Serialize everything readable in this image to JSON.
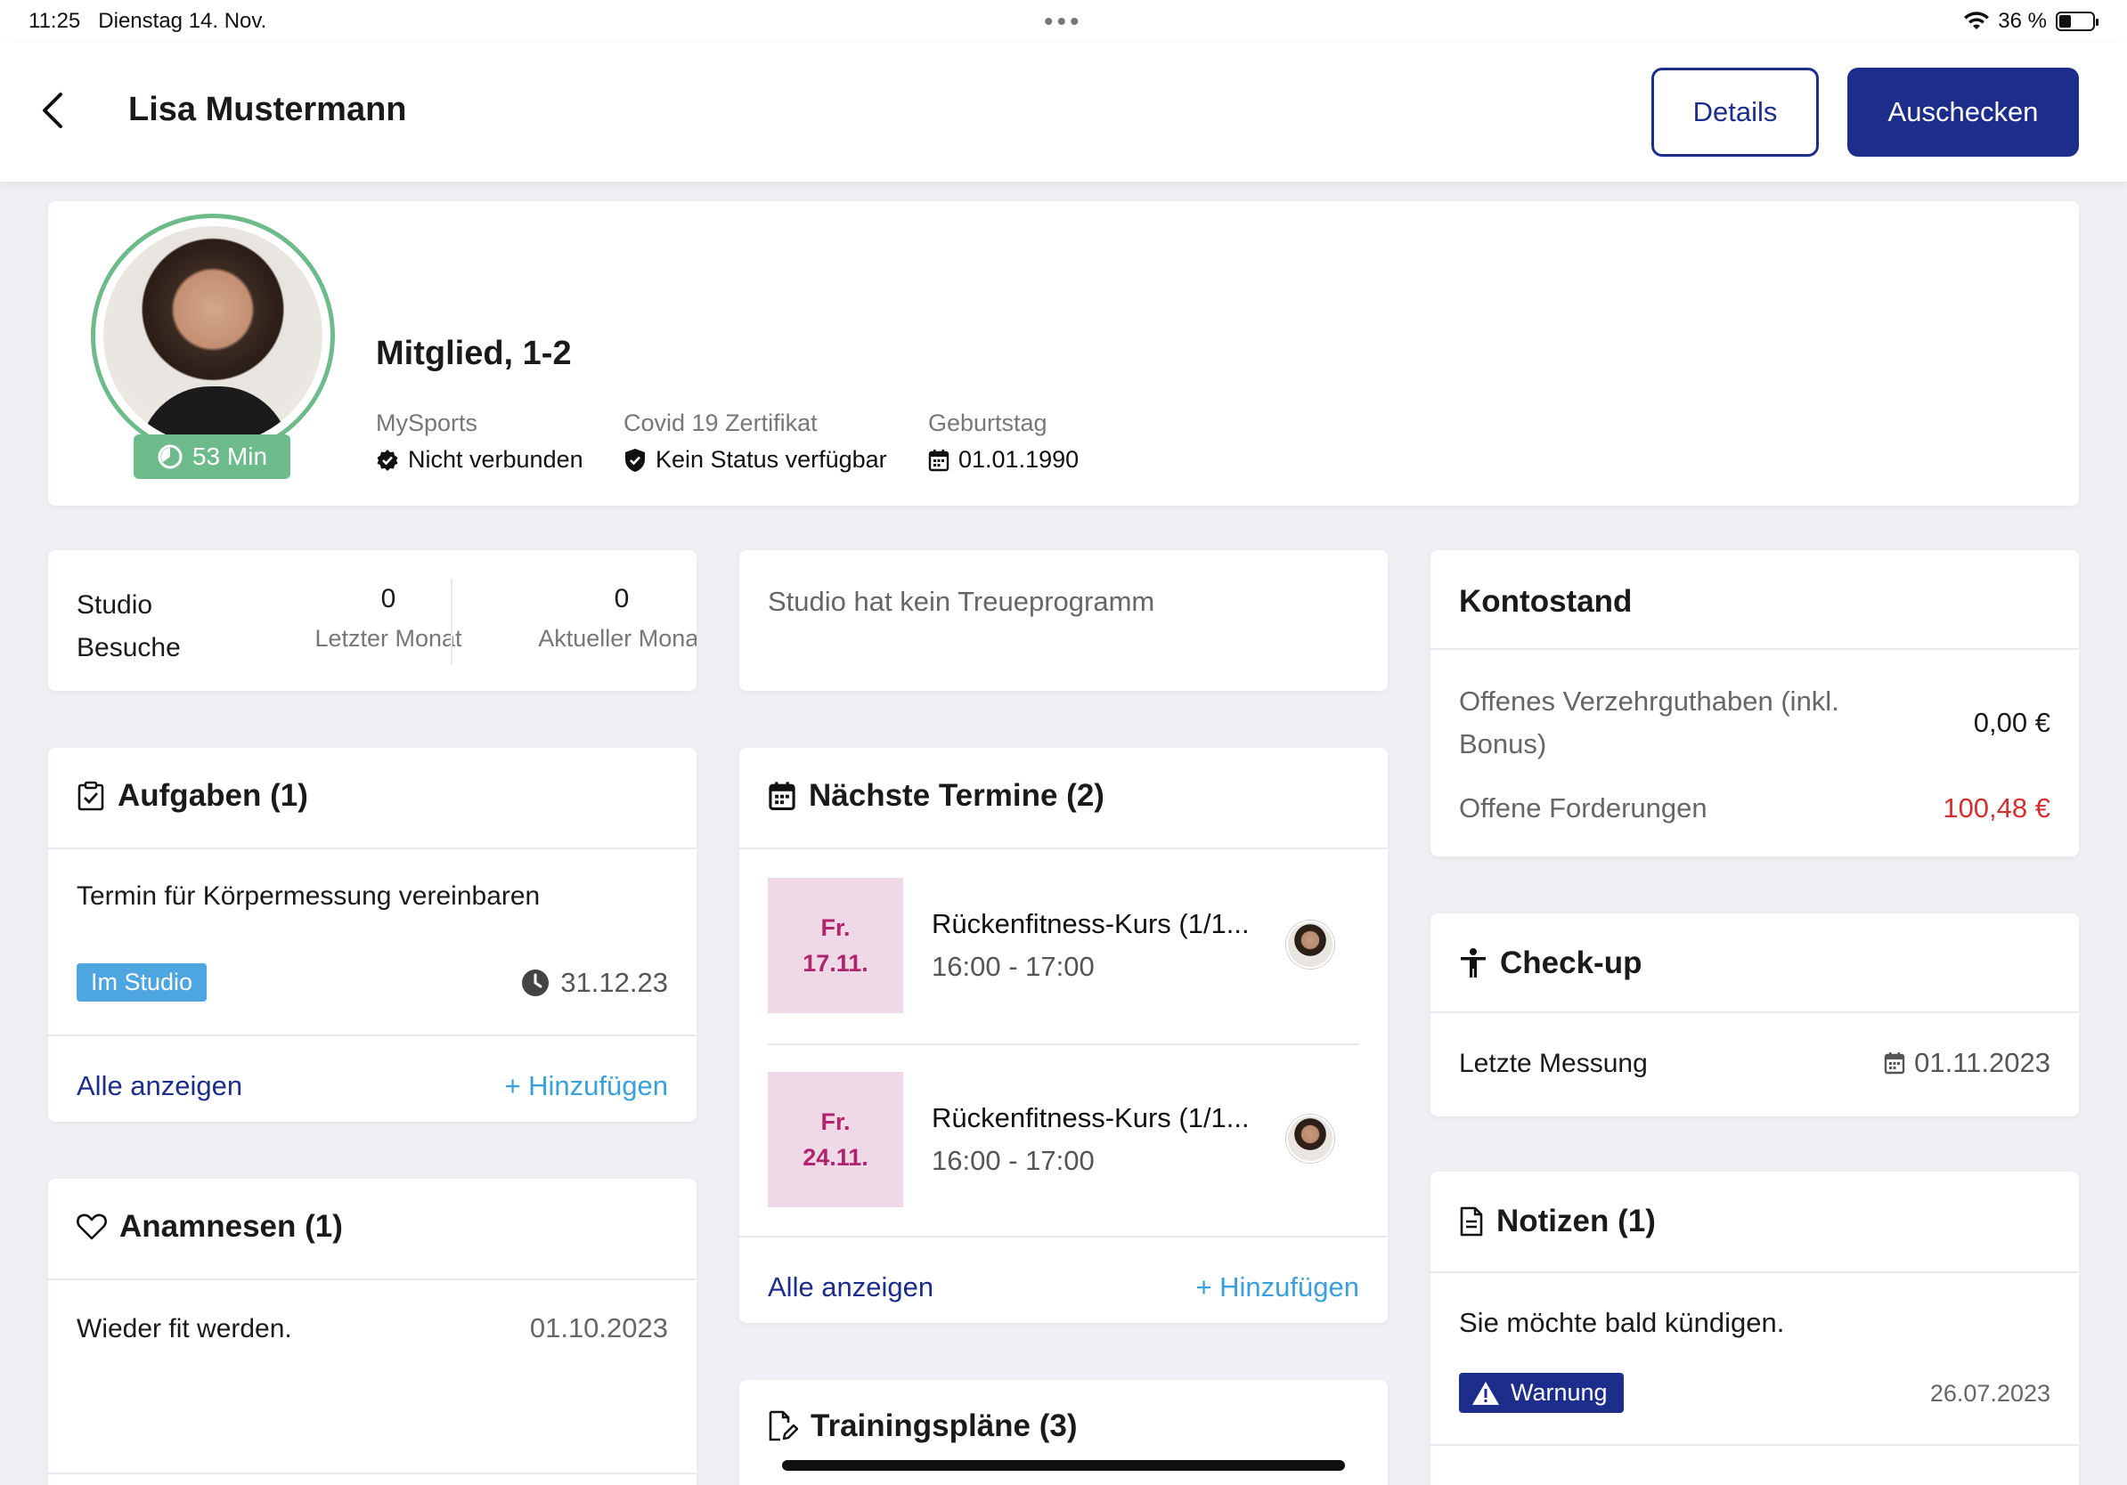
{
  "status_bar": {
    "time": "11:25",
    "date": "Dienstag 14. Nov.",
    "battery": "36 %",
    "battery_level": 0.36
  },
  "header": {
    "title": "Lisa Mustermann",
    "details_label": "Details",
    "checkout_label": "Auschecken"
  },
  "profile": {
    "duration": "53 Min",
    "membership": "Mitglied, 1-2",
    "mysports_label": "MySports",
    "mysports_value": "Nicht verbunden",
    "covid_label": "Covid 19 Zertifikat",
    "covid_value": "Kein Status verfügbar",
    "birthday_label": "Geburtstag",
    "birthday_value": "01.01.1990"
  },
  "visits": {
    "label_line1": "Studio",
    "label_line2": "Besuche",
    "last_month_count": "0",
    "last_month_label": "Letzter Monat",
    "current_month_count": "0",
    "current_month_label": "Aktueller Monat"
  },
  "loyalty": {
    "text": "Studio hat kein Treueprogramm"
  },
  "account": {
    "title": "Kontostand",
    "credit_label_line1": "Offenes Verzehrguthaben (inkl.",
    "credit_label_line2": "Bonus)",
    "credit_value": "0,00 €",
    "claims_label": "Offene Forderungen",
    "claims_value": "100,48 €",
    "claims_color": "#d32f2f"
  },
  "tasks": {
    "title": "Aufgaben (1)",
    "item_text": "Termin für Körpermessung vereinbaren",
    "item_tag": "Im Studio",
    "item_date": "31.12.23",
    "show_all": "Alle anzeigen",
    "add": "+ Hinzufügen"
  },
  "appointments": {
    "title": "Nächste Termine (2)",
    "items": [
      {
        "day": "Fr.",
        "date": "17.11.",
        "title": "Rückenfitness-Kurs (1/1...",
        "time": "16:00 - 17:00"
      },
      {
        "day": "Fr.",
        "date": "24.11.",
        "title": "Rückenfitness-Kurs (1/1...",
        "time": "16:00 - 17:00"
      }
    ],
    "show_all": "Alle anzeigen",
    "add": "+ Hinzufügen"
  },
  "checkup": {
    "title": "Check-up",
    "last_label": "Letzte Messung",
    "last_date": "01.11.2023"
  },
  "anamnesis": {
    "title": "Anamnesen (1)",
    "item_text": "Wieder fit werden.",
    "item_date": "01.10.2023"
  },
  "notes": {
    "title": "Notizen (1)",
    "item_text": "Sie möchte bald kündigen.",
    "item_tag": "Warnung",
    "item_date": "26.07.2023"
  },
  "training": {
    "title": "Trainingspläne (3)"
  }
}
